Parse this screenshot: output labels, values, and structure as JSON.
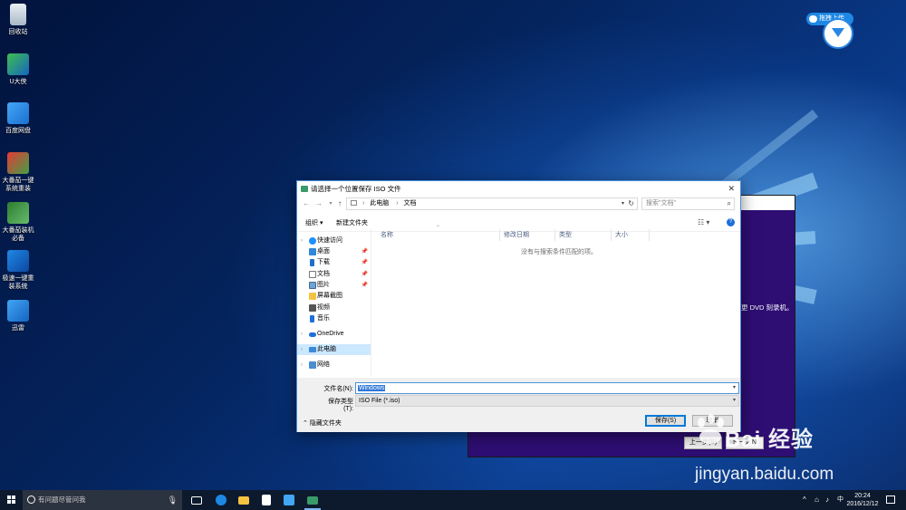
{
  "desktop": {
    "icons": [
      {
        "label": "回收站",
        "icon": "recycle-bin-icon"
      },
      {
        "label": "U大侠",
        "icon": "udaxia-icon"
      },
      {
        "label": "百度网盘",
        "icon": "baidu-netdisk-icon"
      },
      {
        "label": "大番茄一键系统重装",
        "icon": "dafanqie-icon"
      },
      {
        "label": "大番茄装机必备",
        "icon": "dafanqie-bibei-icon"
      },
      {
        "label": "极速一键重装系统",
        "icon": "jisu-reinstall-icon"
      },
      {
        "label": "迅雷",
        "icon": "xunlei-icon"
      }
    ],
    "upload_widget": {
      "label": "拖拽上传"
    },
    "watermark": {
      "brand": "Bai 经验",
      "url": "jingyan.baidu.com"
    }
  },
  "background_window": {
    "text": "更 DVD 刻录机。",
    "button_prev": "上一步(B)",
    "button_next": "下一步(N)"
  },
  "dialog": {
    "title": "请选择一个位置保存 ISO 文件",
    "close": "✕",
    "address": {
      "root": "此电脑",
      "folder": "文档"
    },
    "search_placeholder": "搜索\"文档\"",
    "toolbar": {
      "organize": "组织 ▾",
      "new_folder": "新建文件夹"
    },
    "nav": {
      "quick_access": "快速访问",
      "items": [
        {
          "label": "桌面",
          "pinned": true
        },
        {
          "label": "下载",
          "pinned": true
        },
        {
          "label": "文档",
          "pinned": true
        },
        {
          "label": "图片",
          "pinned": true
        },
        {
          "label": "屏幕截图",
          "pinned": false
        },
        {
          "label": "视频",
          "pinned": false
        },
        {
          "label": "音乐",
          "pinned": false
        }
      ],
      "onedrive": "OneDrive",
      "this_pc": "此电脑",
      "network": "网络"
    },
    "columns": [
      "名称",
      "修改日期",
      "类型",
      "大小"
    ],
    "empty_message": "没有与搜索条件匹配的项。",
    "filename_label": "文件名(N):",
    "filename_value": "Windows",
    "filetype_label": "保存类型(T):",
    "filetype_value": "ISO File (*.iso)",
    "hide_folders": "隐藏文件夹",
    "save_button": "保存(S)",
    "cancel_button": "取消"
  },
  "taskbar": {
    "search_placeholder": "有问题尽管问我",
    "lang": "中",
    "time": "20:24",
    "date": "2016/12/12"
  },
  "colors": {
    "accent": "#0078d7",
    "selection": "#cce8ff",
    "bg_window": "#2e0e73"
  }
}
